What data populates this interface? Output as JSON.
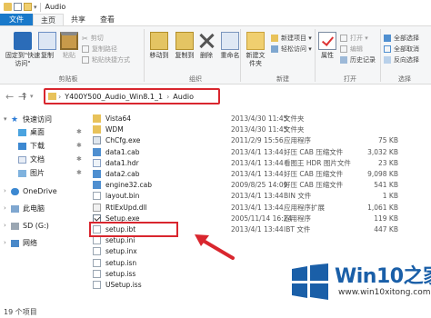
{
  "window": {
    "title": "Audio"
  },
  "ribbon_tabs": [
    "文件",
    "主页",
    "共享",
    "查看"
  ],
  "ribbon": {
    "pin_label": "固定到\"快速访问\"",
    "copy_label": "复制",
    "paste_label": "粘贴",
    "cut_label": "剪切",
    "copy_path_label": "复制路径",
    "paste_shortcut_label": "粘贴快捷方式",
    "move_to_label": "移动到",
    "copy_to_label": "复制到",
    "delete_label": "删除",
    "rename_label": "重命名",
    "new_item_label": "新建项目 ▾",
    "easy_access_label": "轻松访问 ▾",
    "new_folder_label": "新建文件夹",
    "properties_label": "属性",
    "open_label": "打开 ▾",
    "edit_label": "编辑",
    "history_label": "历史记录",
    "select_all_label": "全部选择",
    "select_none_label": "全部取消",
    "invert_label": "反向选择",
    "group_clipboard": "剪贴板",
    "group_organize": "组织",
    "group_new": "新建",
    "group_open": "打开",
    "group_select": "选择"
  },
  "address": {
    "segments": [
      "Y400Y500_Audio_Win8.1_1",
      "Audio"
    ],
    "sep": "›"
  },
  "nav": {
    "quick_access": "快速访问",
    "desktop": "桌面",
    "downloads": "下载",
    "documents": "文档",
    "pictures": "图片",
    "onedrive": "OneDrive",
    "this_pc": "此电脑",
    "sd": "SD (G:)",
    "network": "网络"
  },
  "files": [
    {
      "name": "Vista64",
      "date": "2013/4/30 11:45",
      "type": "文件夹",
      "size": "",
      "icon": "folder"
    },
    {
      "name": "WDM",
      "date": "2013/4/30 11:45",
      "type": "文件夹",
      "size": "",
      "icon": "folder"
    },
    {
      "name": "ChCfg.exe",
      "date": "2011/2/9 15:56",
      "type": "应用程序",
      "size": "75 KB",
      "icon": "exe"
    },
    {
      "name": "data1.cab",
      "date": "2013/4/1 13:44",
      "type": "好压 CAB 压缩文件",
      "size": "3,032 KB",
      "icon": "cab"
    },
    {
      "name": "data1.hdr",
      "date": "2013/4/1 13:44",
      "type": "看图王 HDR 图片文件",
      "size": "23 KB",
      "icon": "hdr"
    },
    {
      "name": "data2.cab",
      "date": "2013/4/1 13:44",
      "type": "好压 CAB 压缩文件",
      "size": "9,098 KB",
      "icon": "cab"
    },
    {
      "name": "engine32.cab",
      "date": "2009/8/25 14:09",
      "type": "好压 CAB 压缩文件",
      "size": "541 KB",
      "icon": "cab"
    },
    {
      "name": "layout.bin",
      "date": "2013/4/1 13:44",
      "type": "BIN 文件",
      "size": "1 KB",
      "icon": "bin"
    },
    {
      "name": "RtlExUpd.dll",
      "date": "2013/4/1 13:44",
      "type": "应用程序扩展",
      "size": "1,061 KB",
      "icon": "dll"
    },
    {
      "name": "Setup.exe",
      "date": "2005/11/14 16:24",
      "type": "应用程序",
      "size": "119 KB",
      "icon": "setup"
    },
    {
      "name": "setup.ibt",
      "date": "2013/4/1 13:44",
      "type": "IBT 文件",
      "size": "447 KB",
      "icon": "txt"
    },
    {
      "name": "setup.ini",
      "date": "",
      "type": "",
      "size": "",
      "icon": "txt"
    },
    {
      "name": "setup.inx",
      "date": "",
      "type": "",
      "size": "",
      "icon": "txt"
    },
    {
      "name": "setup.isn",
      "date": "",
      "type": "",
      "size": "",
      "icon": "txt"
    },
    {
      "name": "setup.iss",
      "date": "",
      "type": "",
      "size": "",
      "icon": "txt"
    },
    {
      "name": "USetup.iss",
      "date": "",
      "type": "",
      "size": "",
      "icon": "txt"
    }
  ],
  "status": {
    "count": "19 个项目"
  },
  "watermark": {
    "brand": "Win10",
    "suffix": "之家",
    "url": "www.win10xitong.com"
  },
  "colors": {
    "accent": "#1979ca",
    "highlight_red": "#d9262e",
    "watermark_blue": "#1a5fa8"
  }
}
